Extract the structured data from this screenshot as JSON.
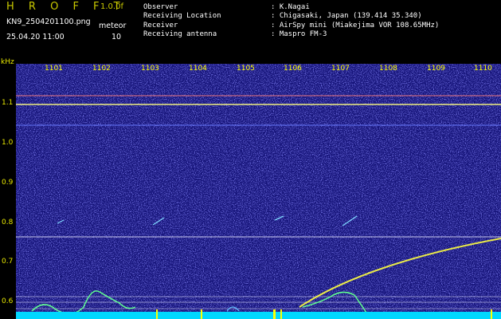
{
  "header": {
    "app_title": "H R O F F T",
    "version": "1.0.0f",
    "filename": "KN9_2504201100.png",
    "datetime": "25.04.20 11:00",
    "meteor_label": "meteor",
    "meteor_count": "10"
  },
  "meta": [
    {
      "label": "Observer",
      "value": ": K.Nagai"
    },
    {
      "label": "Receiving Location",
      "value": ": Chigasaki, Japan (139.414 35.340)"
    },
    {
      "label": "Receiver",
      "value": ": AirSpy mini (Miakejima VOR 108.65MHz)"
    },
    {
      "label": "Receiving antenna",
      "value": ": Maspro FM-3"
    }
  ],
  "axis": {
    "unit": "kHz",
    "y_ticks": [
      "1.1",
      "1.0",
      "0.9",
      "0.8",
      "0.7",
      "0.6"
    ],
    "x_ticks": [
      "1101",
      "1102",
      "1103",
      "1104",
      "1105",
      "1106",
      "1107",
      "1108",
      "1109",
      "1110"
    ]
  },
  "colors": {
    "background": "#000000",
    "spectrogram_base": "#16147a",
    "noise": "#3c3cff",
    "signal": "#ffff00",
    "grid_line": "#ffffff",
    "bottom_band": "#00e0ff"
  }
}
